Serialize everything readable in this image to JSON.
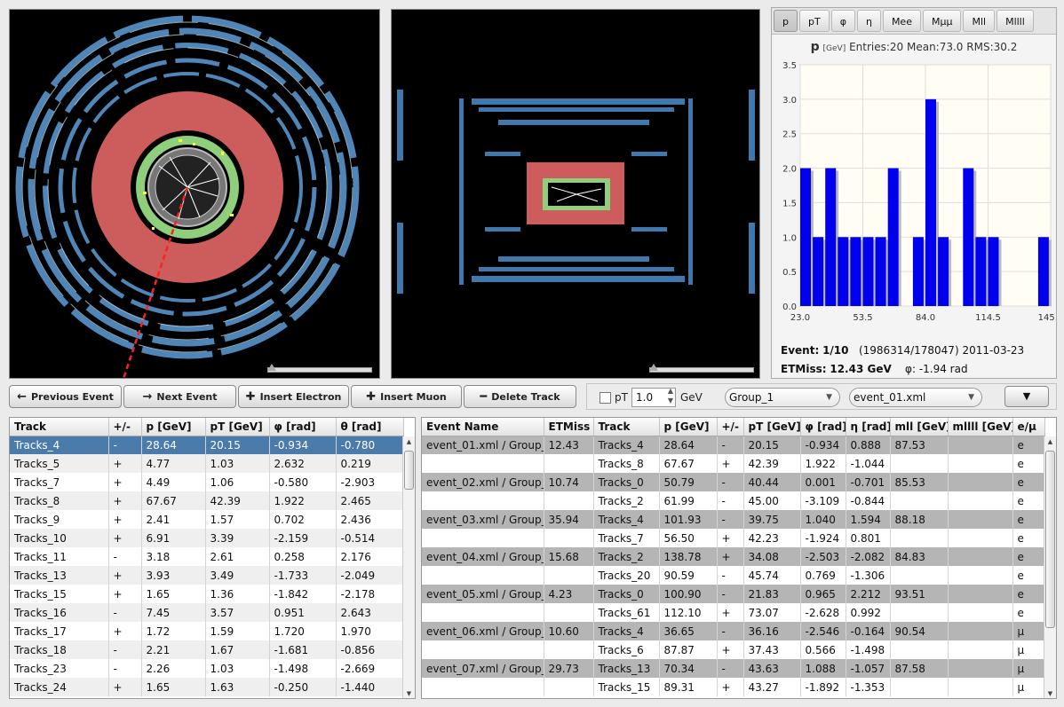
{
  "histogram": {
    "tabs": [
      "p",
      "pT",
      "φ",
      "η",
      "Mee",
      "Mμμ",
      "Mll",
      "Mllll"
    ],
    "active_tab": "p",
    "title_var": "p",
    "title_unit": "[GeV]",
    "title_stats": "Entries:20 Mean:73.0 RMS:30.2",
    "y_ticks": [
      "0.0",
      "0.5",
      "1.0",
      "1.5",
      "2.0",
      "2.5",
      "3.0",
      "3.5"
    ],
    "x_ticks": [
      "23.0",
      "53.5",
      "84.0",
      "114.5",
      "145.0"
    ],
    "bar_color": "#0000ee"
  },
  "chart_data": {
    "type": "bar",
    "title": "p [GeV] Entries:20 Mean:73.0 RMS:30.2",
    "xlabel": "",
    "ylabel": "",
    "xlim": [
      23.0,
      145.0
    ],
    "ylim": [
      0,
      3.5
    ],
    "bin_width": 6.1,
    "bins": [
      {
        "x": 23.0,
        "count": 2
      },
      {
        "x": 29.1,
        "count": 1
      },
      {
        "x": 35.2,
        "count": 2
      },
      {
        "x": 41.3,
        "count": 1
      },
      {
        "x": 47.4,
        "count": 1
      },
      {
        "x": 53.5,
        "count": 1
      },
      {
        "x": 59.6,
        "count": 1
      },
      {
        "x": 65.7,
        "count": 2
      },
      {
        "x": 71.8,
        "count": 0
      },
      {
        "x": 77.9,
        "count": 1
      },
      {
        "x": 84.0,
        "count": 3
      },
      {
        "x": 90.1,
        "count": 1
      },
      {
        "x": 96.2,
        "count": 0
      },
      {
        "x": 102.3,
        "count": 2
      },
      {
        "x": 108.4,
        "count": 1
      },
      {
        "x": 114.5,
        "count": 1
      },
      {
        "x": 120.6,
        "count": 0
      },
      {
        "x": 126.7,
        "count": 0
      },
      {
        "x": 132.8,
        "count": 0
      },
      {
        "x": 138.9,
        "count": 1
      }
    ]
  },
  "event_info": {
    "event_label": "Event:",
    "event_value": "1/10",
    "run_info": "(1986314/178047) 2011-03-23",
    "etmiss_label": "ETMiss:",
    "etmiss_value": "12.43 GeV",
    "phi_text": "φ: -1.94 rad"
  },
  "toolbar": {
    "prev_event": "Previous Event",
    "next_event": "Next Event",
    "insert_electron": "Insert Electron",
    "insert_muon": "Insert Muon",
    "delete_track": "Delete Track"
  },
  "controls": {
    "pt_label": "pT",
    "pt_value": "1.0",
    "unit": "GeV",
    "group": "Group_1",
    "file": "event_01.xml",
    "menu_button": "▼"
  },
  "track_table": {
    "headers": [
      "Track",
      "+/-",
      "p [GeV]",
      "pT [GeV]",
      "φ [rad]",
      "θ [rad]"
    ],
    "rows": [
      [
        "Tracks_4",
        "-",
        "28.64",
        "20.15",
        "-0.934",
        "-0.780"
      ],
      [
        "Tracks_5",
        "+",
        "4.77",
        "1.03",
        "2.632",
        "0.219"
      ],
      [
        "Tracks_7",
        "+",
        "4.49",
        "1.06",
        "-0.580",
        "-2.903"
      ],
      [
        "Tracks_8",
        "+",
        "67.67",
        "42.39",
        "1.922",
        "2.465"
      ],
      [
        "Tracks_9",
        "+",
        "2.41",
        "1.57",
        "0.702",
        "2.436"
      ],
      [
        "Tracks_10",
        "+",
        "6.91",
        "3.39",
        "-2.159",
        "-0.514"
      ],
      [
        "Tracks_11",
        "-",
        "3.18",
        "2.61",
        "0.258",
        "2.176"
      ],
      [
        "Tracks_13",
        "+",
        "3.93",
        "3.49",
        "-1.733",
        "-2.049"
      ],
      [
        "Tracks_15",
        "+",
        "1.65",
        "1.36",
        "-1.842",
        "-2.178"
      ],
      [
        "Tracks_16",
        "-",
        "7.45",
        "3.57",
        "0.951",
        "2.643"
      ],
      [
        "Tracks_17",
        "+",
        "1.72",
        "1.59",
        "1.720",
        "1.970"
      ],
      [
        "Tracks_18",
        "-",
        "2.21",
        "1.67",
        "-1.681",
        "-0.856"
      ],
      [
        "Tracks_23",
        "-",
        "2.26",
        "1.03",
        "-1.498",
        "-2.669"
      ],
      [
        "Tracks_24",
        "+",
        "1.65",
        "1.63",
        "-0.250",
        "-1.440"
      ]
    ]
  },
  "events_table": {
    "headers": [
      "Event Name",
      "ETMiss [",
      "Track",
      "p [GeV]",
      "+/-",
      "pT [GeV]",
      "φ [rad]",
      "η [rad]",
      "mll [GeV]",
      "mllll [GeV]",
      "e/μ"
    ],
    "rows": [
      [
        "event_01.xml / Group_",
        "12.43",
        "Tracks_4",
        "28.64",
        "-",
        "20.15",
        "-0.934",
        "0.888",
        "87.53",
        "",
        "e"
      ],
      [
        "",
        "",
        "Tracks_8",
        "67.67",
        "+",
        "42.39",
        "1.922",
        "-1.044",
        "",
        "",
        "e"
      ],
      [
        "event_02.xml / Group_",
        "10.74",
        "Tracks_0",
        "50.79",
        "-",
        "40.44",
        "0.001",
        "-0.701",
        "85.53",
        "",
        "e"
      ],
      [
        "",
        "",
        "Tracks_2",
        "61.99",
        "-",
        "45.00",
        "-3.109",
        "-0.844",
        "",
        "",
        "e"
      ],
      [
        "event_03.xml / Group_",
        "35.94",
        "Tracks_4",
        "101.93",
        "-",
        "39.75",
        "1.040",
        "1.594",
        "88.18",
        "",
        "e"
      ],
      [
        "",
        "",
        "Tracks_7",
        "56.50",
        "+",
        "42.23",
        "-1.924",
        "0.801",
        "",
        "",
        "e"
      ],
      [
        "event_04.xml / Group_",
        "15.68",
        "Tracks_2",
        "138.78",
        "+",
        "34.08",
        "-2.503",
        "-2.082",
        "84.83",
        "",
        "e"
      ],
      [
        "",
        "",
        "Tracks_20",
        "90.59",
        "-",
        "45.74",
        "0.769",
        "-1.306",
        "",
        "",
        "e"
      ],
      [
        "event_05.xml / Group_",
        "4.23",
        "Tracks_0",
        "100.90",
        "-",
        "21.83",
        "0.965",
        "2.212",
        "93.51",
        "",
        "e"
      ],
      [
        "",
        "",
        "Tracks_61",
        "112.10",
        "+",
        "73.07",
        "-2.628",
        "0.992",
        "",
        "",
        "e"
      ],
      [
        "event_06.xml / Group_",
        "10.60",
        "Tracks_4",
        "36.65",
        "-",
        "36.16",
        "-2.546",
        "-0.164",
        "90.54",
        "",
        "μ"
      ],
      [
        "",
        "",
        "Tracks_6",
        "87.87",
        "+",
        "37.43",
        "0.566",
        "-1.498",
        "",
        "",
        "μ"
      ],
      [
        "event_07.xml / Group_",
        "29.73",
        "Tracks_13",
        "70.34",
        "-",
        "43.63",
        "1.088",
        "-1.057",
        "87.58",
        "",
        "μ"
      ],
      [
        "",
        "",
        "Tracks_15",
        "89.31",
        "+",
        "43.27",
        "-1.892",
        "-1.353",
        "",
        "",
        "μ"
      ]
    ]
  }
}
